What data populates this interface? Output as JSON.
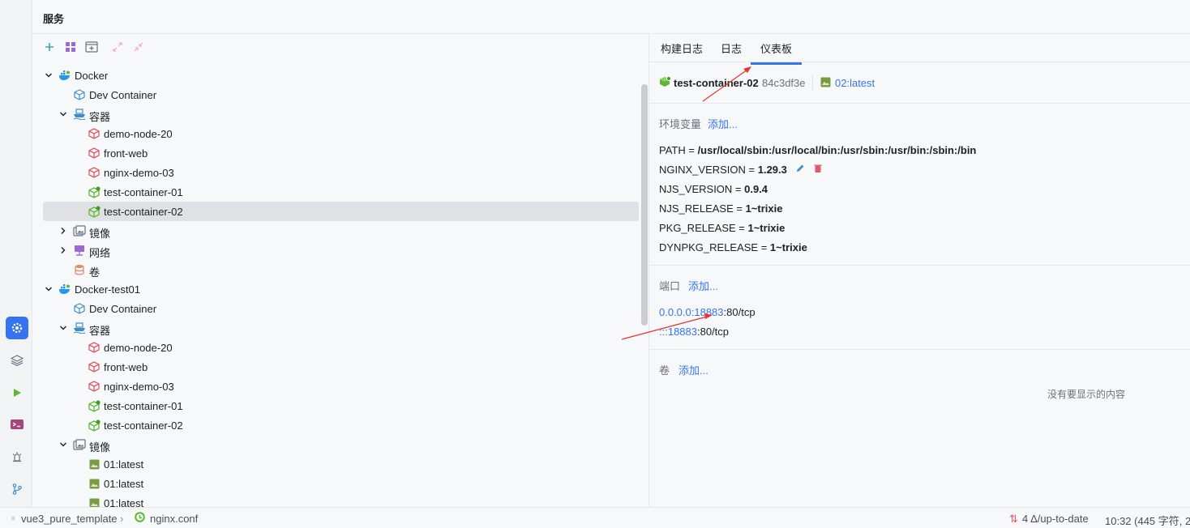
{
  "header": {
    "title": "服务"
  },
  "tree": [
    {
      "name": "tree-row-docker",
      "label": "Docker",
      "expanded": true,
      "icon": "docker-icon"
    },
    {
      "name": "tree-row-dev-container",
      "label": "Dev Container",
      "icon": "cube-outline-icon"
    },
    {
      "name": "tree-row-containers",
      "label": "容器",
      "expanded": true,
      "icon": "ship-icon"
    },
    {
      "name": "tree-row-container",
      "label": "demo-node-20",
      "icon": "container-stopped-icon"
    },
    {
      "name": "tree-row-container",
      "label": "front-web",
      "icon": "container-stopped-icon"
    },
    {
      "name": "tree-row-container",
      "label": "nginx-demo-03",
      "icon": "container-stopped-icon"
    },
    {
      "name": "tree-row-container",
      "label": "test-container-01",
      "icon": "container-running-icon"
    },
    {
      "name": "tree-row-container",
      "label": "test-container-02",
      "icon": "container-running-icon",
      "selected": true
    },
    {
      "name": "tree-row-images",
      "label": "镜像",
      "expanded": false,
      "icon": "images-icon"
    },
    {
      "name": "tree-row-networks",
      "label": "网络",
      "expanded": false,
      "icon": "network-icon"
    },
    {
      "name": "tree-row-volumes",
      "label": "卷",
      "icon": "volume-icon"
    },
    {
      "name": "tree-row-docker",
      "label": "Docker-test01",
      "expanded": true,
      "icon": "docker-icon"
    },
    {
      "name": "tree-row-dev-container",
      "label": "Dev Container",
      "icon": "cube-outline-icon"
    },
    {
      "name": "tree-row-containers",
      "label": "容器",
      "expanded": true,
      "icon": "ship-icon"
    },
    {
      "name": "tree-row-container",
      "label": "demo-node-20",
      "icon": "container-stopped-icon"
    },
    {
      "name": "tree-row-container",
      "label": "front-web",
      "icon": "container-stopped-icon"
    },
    {
      "name": "tree-row-container",
      "label": "nginx-demo-03",
      "icon": "container-stopped-icon"
    },
    {
      "name": "tree-row-container",
      "label": "test-container-01",
      "icon": "container-running-icon"
    },
    {
      "name": "tree-row-container",
      "label": "test-container-02",
      "icon": "container-running-icon"
    },
    {
      "name": "tree-row-images",
      "label": "镜像",
      "expanded": true,
      "icon": "images-icon"
    },
    {
      "name": "tree-row-image",
      "label": "01:latest",
      "icon": "image-icon"
    },
    {
      "name": "tree-row-image",
      "label": "01:latest",
      "icon": "image-icon"
    },
    {
      "name": "tree-row-image",
      "label": "01:latest",
      "icon": "image-icon"
    }
  ],
  "tabs": [
    {
      "label": "构建日志"
    },
    {
      "label": "日志"
    },
    {
      "label": "仪表板",
      "active": true
    }
  ],
  "container": {
    "name": "test-container-02",
    "id": "84c3df3e",
    "image": "02:latest"
  },
  "env": {
    "title": "环境变量",
    "add": "添加...",
    "vars": [
      {
        "key": "PATH",
        "value": "/usr/local/sbin:/usr/local/bin:/usr/sbin:/usr/bin:/sbin:/bin"
      },
      {
        "key": "NGINX_VERSION",
        "value": "1.29.3"
      },
      {
        "key": "NJS_VERSION",
        "value": "0.9.4"
      },
      {
        "key": "NJS_RELEASE",
        "value": "1~trixie"
      },
      {
        "key": "PKG_RELEASE",
        "value": "1~trixie"
      },
      {
        "key": "DYNPKG_RELEASE",
        "value": "1~trixie"
      }
    ],
    "eq": "="
  },
  "ports": {
    "title": "端口",
    "add": "添加...",
    "items": [
      {
        "host": "0.0.0.0:18883",
        "container": ":80/tcp"
      },
      {
        "host": ":::18883",
        "container": ":80/tcp"
      }
    ]
  },
  "volumes": {
    "title": "卷",
    "add": "添加...",
    "empty": "没有要显示的内容"
  },
  "status": {
    "project": "vue3_pure_template",
    "file": "nginx.conf",
    "vcs": "4 Δ/up-to-date",
    "position": "10:32 (445 字符, 2"
  },
  "colors": {
    "accent": "#3574f0",
    "running": "#5fb832",
    "stopped": "#e55765",
    "annotation": "#e8322c"
  }
}
